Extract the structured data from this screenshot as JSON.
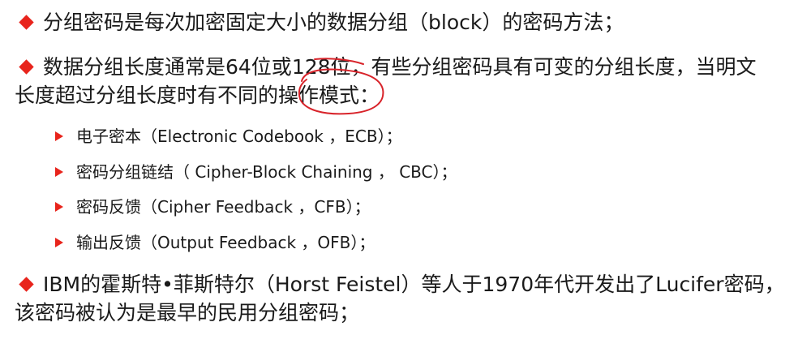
{
  "bullets": [
    {
      "text": "分组密码是每次加密固定大小的数据分组（block）的密码方法；"
    },
    {
      "line1": "数据分组长度通常是64位或128位，有些分组密码具有可变的分组长度，当明文",
      "line2a": "长度超过分组长度时有不同的",
      "line2b": "操作模式",
      "line2c": "："
    },
    {
      "line1": "IBM的霍斯特•菲斯特尔（Horst Feistel）等人于1970年代开发出了Lucifer密码，",
      "line2": "该密码被认为是最早的民用分组密码；"
    }
  ],
  "modes": [
    "电子密本（Electronic Codebook ，ECB）；",
    "密码分组链结（ Cipher-Block Chaining ， CBC）；",
    "密码反馈（Cipher Feedback ，CFB）；",
    "输出反馈（Output Feedback ，OFB）；"
  ],
  "colors": {
    "bullet": "#e8241c",
    "annotation": "#d8232a"
  }
}
